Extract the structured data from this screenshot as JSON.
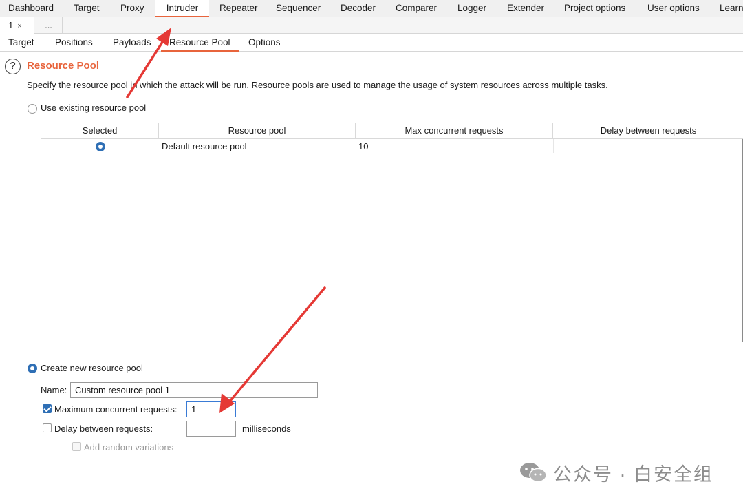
{
  "top_tabs": [
    {
      "label": "Dashboard",
      "active": false
    },
    {
      "label": "Target",
      "active": false
    },
    {
      "label": "Proxy",
      "active": false
    },
    {
      "label": "Intruder",
      "active": true
    },
    {
      "label": "Repeater",
      "active": false
    },
    {
      "label": "Sequencer",
      "active": false
    },
    {
      "label": "Decoder",
      "active": false
    },
    {
      "label": "Comparer",
      "active": false
    },
    {
      "label": "Logger",
      "active": false
    },
    {
      "label": "Extender",
      "active": false
    },
    {
      "label": "Project options",
      "active": false
    },
    {
      "label": "User options",
      "active": false
    },
    {
      "label": "Learn",
      "active": false
    }
  ],
  "attack_tabs": {
    "current": "1",
    "close": "×",
    "more": "..."
  },
  "inner_tabs": [
    {
      "label": "Target",
      "active": false
    },
    {
      "label": "Positions",
      "active": false
    },
    {
      "label": "Payloads",
      "active": false
    },
    {
      "label": "Resource Pool",
      "active": true
    },
    {
      "label": "Options",
      "active": false
    }
  ],
  "section": {
    "help_glyph": "?",
    "title": "Resource Pool",
    "description": "Specify the resource pool in which the attack will be run. Resource pools are used to manage the usage of system resources across multiple tasks."
  },
  "existing_pool": {
    "label": "Use existing resource pool",
    "selected": false,
    "columns": [
      "Selected",
      "Resource pool",
      "Max concurrent requests",
      "Delay between requests"
    ],
    "rows": [
      {
        "selected": true,
        "name": "Default resource pool",
        "max_concurrent": "10",
        "delay": ""
      }
    ]
  },
  "new_pool": {
    "label": "Create new resource pool",
    "selected": true,
    "name_label": "Name:",
    "name_value": "Custom resource pool 1",
    "max_label": "Maximum concurrent requests:",
    "max_checked": true,
    "max_value": "1",
    "delay_label": "Delay between requests:",
    "delay_checked": false,
    "delay_value": "",
    "delay_unit": "milliseconds",
    "random_label": "Add random variations",
    "random_checked": false
  },
  "watermark": {
    "text": "公众号 · 白安全组",
    "icon": "wechat-icon"
  },
  "colors": {
    "accent": "#e8643c",
    "selection": "#2f6fb5",
    "annotation_arrow": "#e53935"
  }
}
